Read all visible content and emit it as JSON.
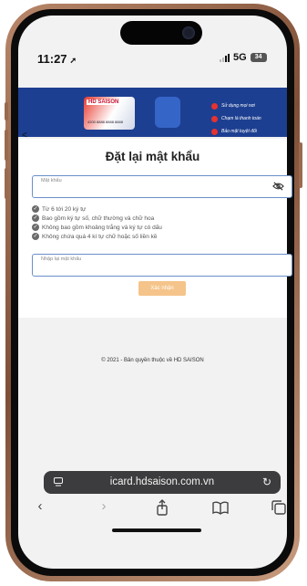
{
  "status_bar": {
    "time": "11:27",
    "network": "5G",
    "battery": "34"
  },
  "banner": {
    "card_brand": "HD SAISON",
    "card_number": "4200 8888 8888 8888",
    "features": [
      "Sử dụng mọi nơi",
      "Chạm là thanh toán",
      "Bảo mật tuyệt đối"
    ],
    "back_glyph": "<"
  },
  "form": {
    "title": "Đặt lại mật khẩu",
    "password_label": "Mật khẩu",
    "rules": [
      "Từ 6 tới 20 ký tự",
      "Bao gồm ký tự số, chữ thường và chữ hoa",
      "Không bao gồm khoảng trắng và ký tự có dấu",
      "Không chứa quá 4 kí tự chữ hoặc số liền kề"
    ],
    "confirm_password_label": "Nhập lại mật khẩu",
    "submit_label": "Xác nhận"
  },
  "footer": {
    "copyright": "© 2021 - Bản quyền thuộc về HD SAISON"
  },
  "browser": {
    "url": "icard.hdsaison.com.vn",
    "toolbar": [
      "back",
      "forward",
      "share",
      "bookmarks",
      "tabs"
    ]
  },
  "colors": {
    "banner_bg": "#1d3f91",
    "field_border": "#6a8fc9",
    "submit_bg": "#f5c48a",
    "frame": "#9a6a4e"
  }
}
